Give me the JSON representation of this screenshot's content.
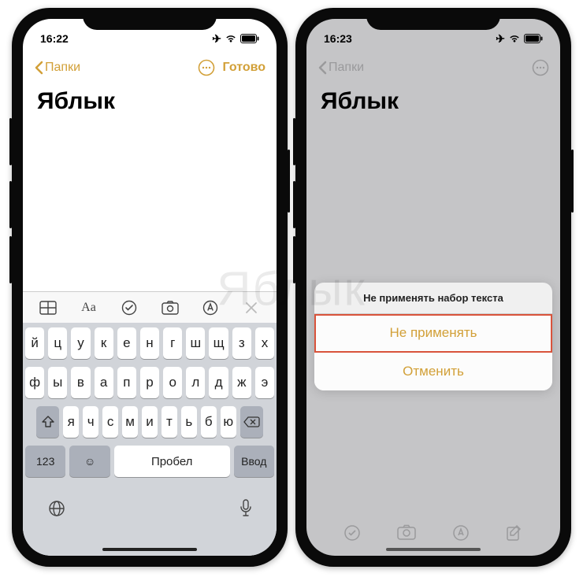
{
  "watermark": "Яблык",
  "left": {
    "time": "16:22",
    "back": "Папки",
    "done": "Готово",
    "title": "Яблык",
    "toolbar_icons": [
      "table-icon",
      "format-icon",
      "checklist-icon",
      "camera-icon",
      "markup-icon",
      "close-icon"
    ],
    "keyboard": {
      "row1": [
        "й",
        "ц",
        "у",
        "к",
        "е",
        "н",
        "г",
        "ш",
        "щ",
        "з",
        "х"
      ],
      "row2": [
        "ф",
        "ы",
        "в",
        "а",
        "п",
        "р",
        "о",
        "л",
        "д",
        "ж",
        "э"
      ],
      "row3": [
        "я",
        "ч",
        "с",
        "м",
        "и",
        "т",
        "ь",
        "б",
        "ю"
      ],
      "numkey": "123",
      "space": "Пробел",
      "enter": "Ввод"
    }
  },
  "right": {
    "time": "16:23",
    "back": "Папки",
    "title": "Яблык",
    "sheet": {
      "title": "Не применять набор текста",
      "undo": "Не применять",
      "cancel": "Отменить"
    }
  }
}
